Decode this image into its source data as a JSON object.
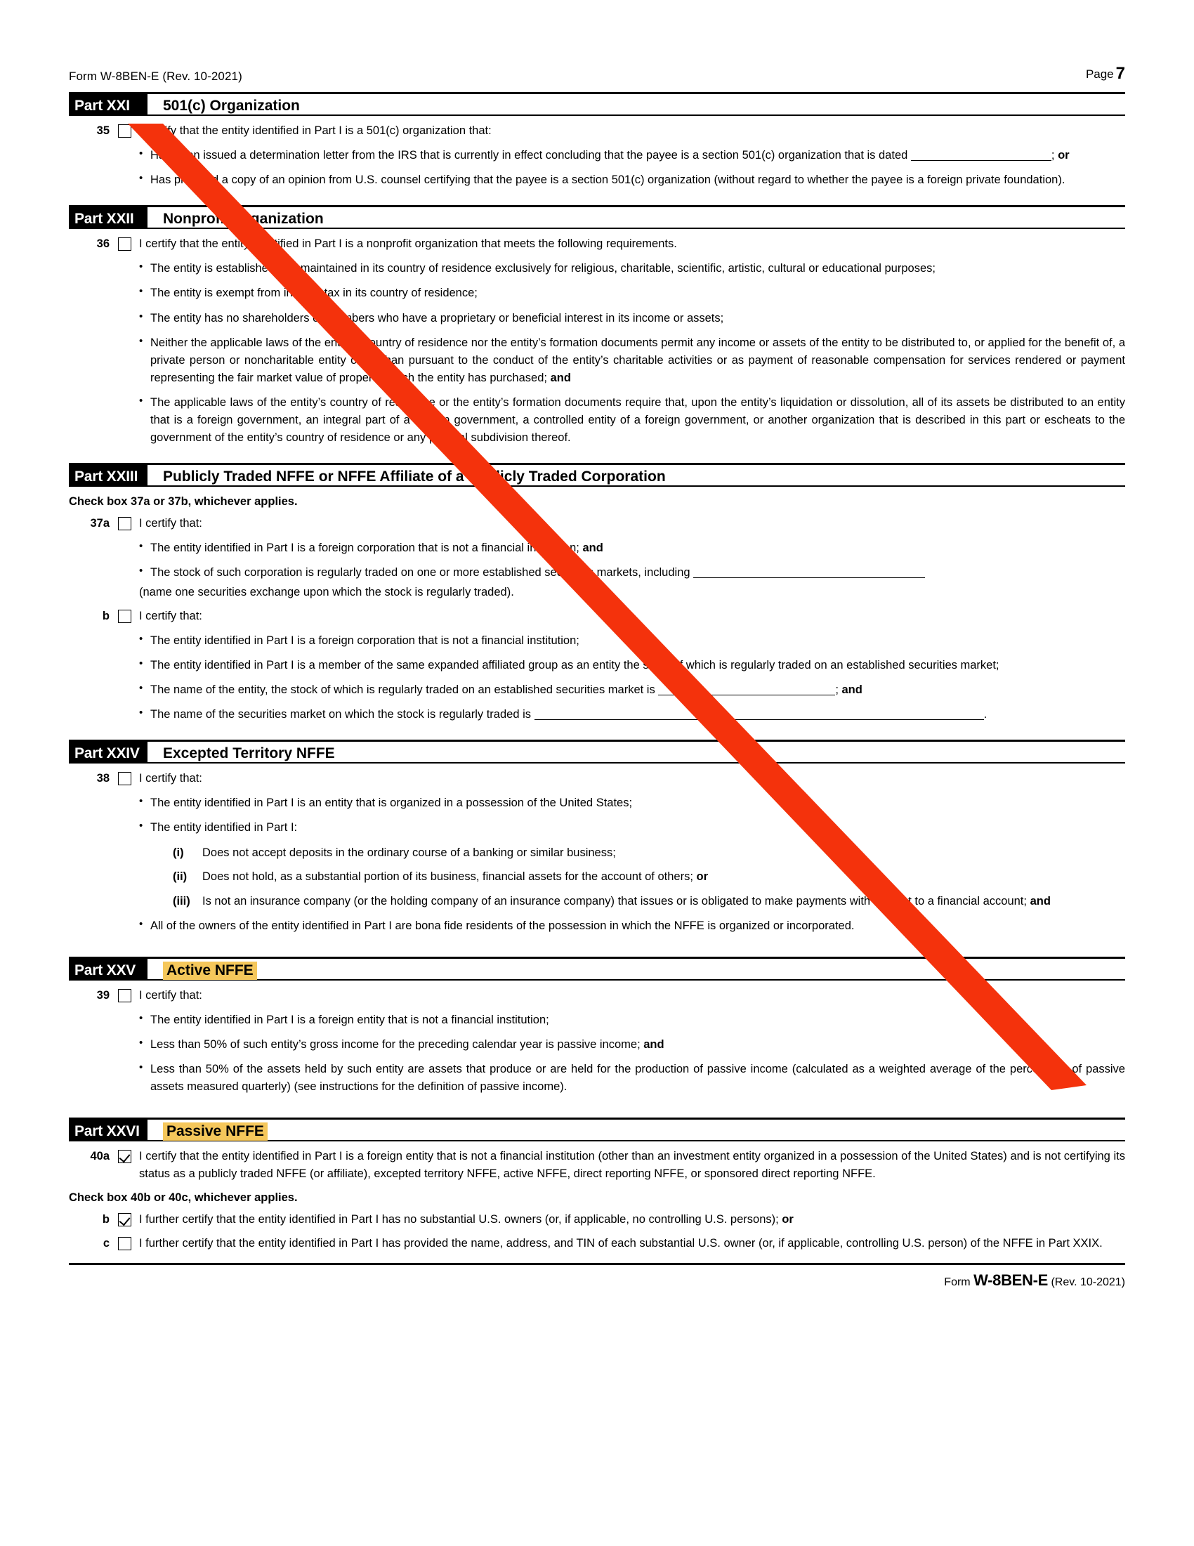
{
  "document": {
    "header_left": "Form W-8BEN-E (Rev. 10-2021)",
    "header_right_label": "Page",
    "header_right_number": "7",
    "footer_prefix": "Form",
    "footer_form": "W-8BEN-E",
    "footer_rev": "(Rev. 10-2021)"
  },
  "annotation": {
    "color": "#f4320c",
    "shape": "diagonal-arrow",
    "start": "checkbox 35 (Part XXI)",
    "end": "bottom of Part XXIV block"
  },
  "parts": {
    "xxi": {
      "tag": "Part XXI",
      "title": "501(c) Organization",
      "highlight": false,
      "item_number": "35",
      "checked": false,
      "lead": "I certify that the entity identified in Part I is a 501(c) organization that:",
      "bullet1_pre": "Has been issued a determination letter from the IRS that is currently in effect concluding that the payee is a section 501(c) organization that is dated",
      "bullet1_post": "; ",
      "bullet1_bold": "or",
      "bullet2": "Has provided a copy of an opinion from U.S. counsel certifying that the payee is a section 501(c) organization (without regard to whether the payee is a foreign private foundation)."
    },
    "xxii": {
      "tag": "Part XXII",
      "title": "Nonprofit Organization",
      "highlight": false,
      "item_number": "36",
      "checked": false,
      "lead": "I certify that the entity identified in Part I is a nonprofit organization that meets the following requirements.",
      "bullets": [
        "The entity is established and maintained in its country of residence exclusively for religious, charitable, scientific, artistic, cultural or educational purposes;",
        "The entity is exempt from income tax in its country of residence;",
        "The entity has no shareholders or members who have a proprietary or beneficial interest in its income or assets;"
      ],
      "bullet4_pre": "Neither the applicable laws of the entity’s country of residence nor the entity’s formation documents permit any income or assets of the entity to be distributed to, or applied for the benefit of, a private person or noncharitable entity other than pursuant to the conduct of the entity’s charitable activities or as payment of reasonable compensation for services rendered or payment representing the fair market value of property which the entity has purchased; ",
      "bullet4_bold": "and",
      "bullet5": "The applicable laws of the entity’s country of residence or the entity’s formation documents require that, upon the entity’s liquidation or dissolution, all of its assets be distributed to an entity that is a foreign government, an integral part of a foreign government, a controlled entity of a foreign government, or another organization that is described in this part or escheats to the government of the entity’s country of residence or any political subdivision thereof."
    },
    "xxiii": {
      "tag": "Part XXIII",
      "title": "Publicly Traded NFFE or NFFE Affiliate of a Publicly Traded Corporation",
      "highlight": false,
      "check_instruction": "Check box 37a or 37b, whichever applies.",
      "a": {
        "item_number": "37a",
        "checked": false,
        "lead": "I certify that:",
        "bullet1_pre": "The entity identified in Part I is a foreign corporation that is not a financial institution; ",
        "bullet1_bold": "and",
        "bullet2_pre": "The stock of such corporation is regularly traded on one or more established securities markets, including",
        "bullet2_post": "(name one securities exchange upon which the stock is regularly traded)."
      },
      "b": {
        "item_number": "b",
        "checked": false,
        "lead": "I certify that:",
        "bullet1": "The entity identified in Part I is a foreign corporation that is not a financial institution;",
        "bullet2": "The entity identified in Part I is a member of the same expanded affiliated group as an entity the stock of which is regularly traded on an established securities market;",
        "bullet3_pre": "The name of the entity, the stock of which is regularly traded on an established securities market is",
        "bullet3_post": "; ",
        "bullet3_bold": "and",
        "bullet4_pre": "The name of the securities market on which the stock is regularly traded is",
        "bullet4_post": "."
      }
    },
    "xxiv": {
      "tag": "Part XXIV",
      "title": "Excepted Territory NFFE",
      "highlight": false,
      "item_number": "38",
      "checked": false,
      "lead": "I certify that:",
      "bullet1": "The entity identified in Part I is an entity that is organized in a possession of the United States;",
      "bullet2": "The entity identified in Part I:",
      "romans": [
        {
          "mark": "(i)",
          "text": "Does not accept deposits in the ordinary course of a banking or similar business;",
          "bold_tail": ""
        },
        {
          "mark": "(ii)",
          "text": "Does not hold, as a substantial portion of its business, financial assets for the account of others; ",
          "bold_tail": "or"
        },
        {
          "mark": "(iii)",
          "text": "Is not an insurance company (or the holding company of an insurance company) that issues or is obligated to make payments with respect to a financial account; ",
          "bold_tail": "and"
        }
      ],
      "bullet3": "All of the owners of the entity identified in Part I are bona fide residents of the possession in which the NFFE is organized or incorporated."
    },
    "xxv": {
      "tag": "Part XXV",
      "title": "Active NFFE",
      "highlight": true,
      "item_number": "39",
      "checked": false,
      "lead": "I certify that:",
      "bullet1": "The entity identified in Part I is a foreign entity that is not a financial institution;",
      "bullet2_pre": "Less than 50% of such entity’s gross income for the preceding calendar year is passive income; ",
      "bullet2_bold": "and",
      "bullet3": "Less than 50% of the assets held by such entity are assets that produce or are held for the production of passive income (calculated as a weighted average of the percentage of passive assets measured quarterly) (see instructions for the definition of passive income)."
    },
    "xxvi": {
      "tag": "Part XXVI",
      "title": "Passive NFFE",
      "highlight": true,
      "a": {
        "item_number": "40a",
        "checked": true,
        "text": "I certify that the entity identified in Part I is a foreign entity that is not a financial institution (other than an investment entity organized in a possession of the United States) and is not certifying its status as a publicly traded NFFE (or affiliate), excepted territory NFFE, active NFFE, direct reporting NFFE, or sponsored direct reporting NFFE."
      },
      "check_instruction": "Check box 40b or 40c, whichever applies.",
      "b": {
        "item_number": "b",
        "checked": true,
        "text_pre": "I further certify that the entity identified in Part I has no substantial U.S. owners (or, if applicable, no controlling U.S. persons); ",
        "text_bold": "or"
      },
      "c": {
        "item_number": "c",
        "checked": false,
        "text": "I further certify that the entity identified in Part I has provided the name, address, and TIN of each substantial U.S. owner (or, if applicable, controlling U.S. person) of the NFFE in Part XXIX."
      }
    }
  }
}
